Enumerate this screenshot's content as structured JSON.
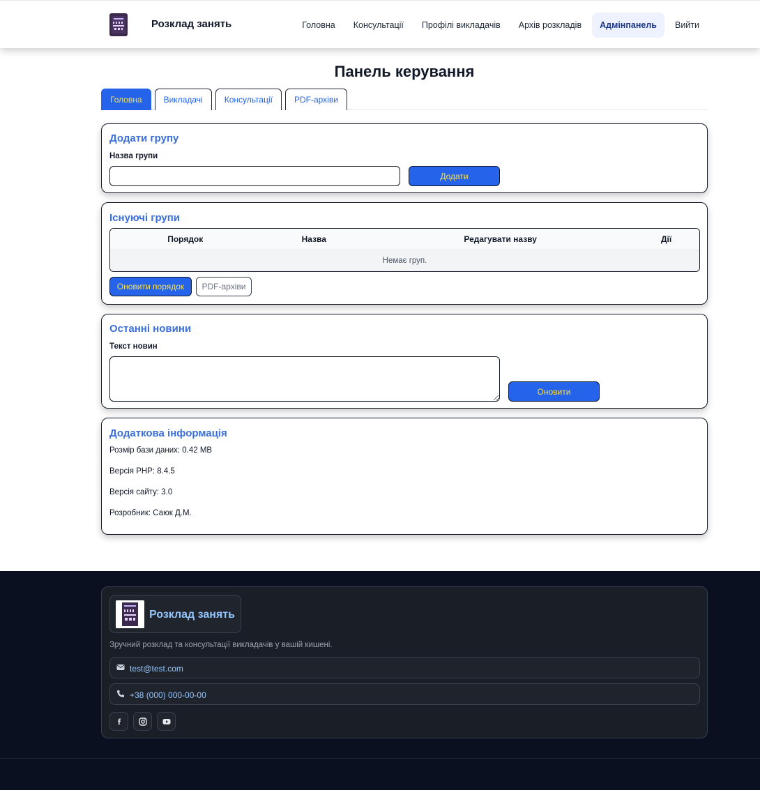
{
  "header": {
    "brand": "Розклад занять",
    "logo_icon": "schedule-logo-icon",
    "nav": [
      {
        "label": "Головна",
        "active": false
      },
      {
        "label": "Консультації",
        "active": false
      },
      {
        "label": "Профілі викладачів",
        "active": false
      },
      {
        "label": "Архів розкладів",
        "active": false
      },
      {
        "label": "Адмінпанель",
        "active": true
      },
      {
        "label": "Вийти",
        "active": false
      }
    ]
  },
  "page": {
    "title": "Панель керування"
  },
  "tabs": [
    {
      "label": "Головна",
      "active": true
    },
    {
      "label": "Викладачі",
      "active": false
    },
    {
      "label": "Консультації",
      "active": false
    },
    {
      "label": "PDF-архіви",
      "active": false
    }
  ],
  "add_group": {
    "title": "Додати групу",
    "field_label": "Назва групи",
    "input_value": "",
    "button": "Додати"
  },
  "groups": {
    "title": "Існуючі групи",
    "columns": [
      "Порядок",
      "Назва",
      "Редагувати назву",
      "Дії"
    ],
    "empty_text": "Немає груп.",
    "update_order_button": "Оновити порядок",
    "pdf_button": "PDF-архіви"
  },
  "news": {
    "title": "Останні новини",
    "field_label": "Текст новин",
    "textarea_value": "",
    "button": "Оновити"
  },
  "info": {
    "title": "Додаткова інформація",
    "lines": [
      "Розмір бази даних: 0.42 MB",
      "Версія PHP: 8.4.5",
      "Версія сайту: 3.0",
      "Розробник: Саюк Д.М."
    ]
  },
  "footer": {
    "brand": "Розклад занять",
    "tagline": "Зручний розклад та консультації викладачів у вашій кишені.",
    "email": "test@test.com",
    "phone": "+38 (000) 000-00-00",
    "email_icon": "mail-icon",
    "phone_icon": "phone-icon",
    "socials": [
      "facebook-icon",
      "instagram-icon",
      "youtube-icon"
    ]
  },
  "colors": {
    "primary": "#2563eb",
    "primary_text": "#fde047",
    "card_title": "#3b6fd8",
    "footer_bg": "#0b1020",
    "footer_link": "#93c5fd"
  }
}
